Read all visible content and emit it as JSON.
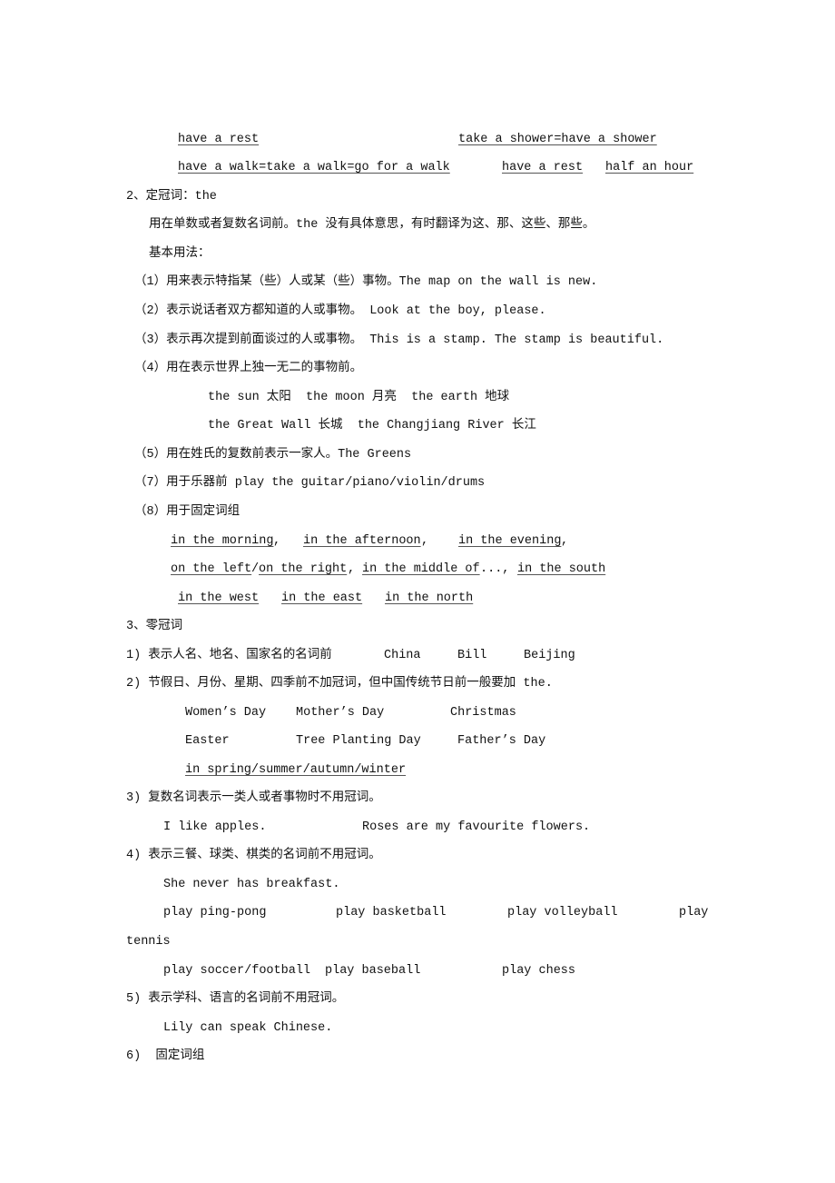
{
  "l1": [
    "have a rest",
    "take a shower=have a shower"
  ],
  "l2": [
    "have a walk=take a walk=go for a walk",
    "have a rest",
    "half an hour"
  ],
  "s2_title": "2、定冠词：the",
  "s2_intro": "用在单数或者复数名词前。the 没有具体意思，有时翻译为这、那、这些、那些。",
  "s2_basic": "基本用法：",
  "s2_items": [
    "（1）用来表示特指某（些）人或某（些）事物。The map on the wall is new.",
    "（2）表示说话者双方都知道的人或事物。 Look at the boy, please.",
    "（3）表示再次提到前面谈过的人或事物。 This is a stamp. The stamp is beautiful.",
    "（4）用在表示世界上独一无二的事物前。",
    "the sun 太阳  the moon 月亮  the earth 地球",
    "the Great Wall 长城  the Changjiang River 长江",
    "（5）用在姓氏的复数前表示一家人。The Greens",
    "（7）用于乐器前 play the guitar/piano/violin/drums",
    "（8）用于固定词组"
  ],
  "phrases1": [
    "in the morning",
    ",",
    "in the afternoon",
    ",",
    "in the evening",
    ","
  ],
  "phrases2": [
    "on the left",
    "/",
    "on the right",
    ",",
    "in the middle of",
    "...,",
    "in the south"
  ],
  "phrases3": [
    "in the west",
    "in the east",
    "in the north"
  ],
  "s3_title": "3、零冠词",
  "s3_1": [
    "1) 表示人名、地名、国家名的名词前",
    "China",
    "Bill",
    "Beijing"
  ],
  "s3_2": "2) 节假日、月份、星期、四季前不加冠词，但中国传统节日前一般要加 the.",
  "holidays1": [
    "Women’s Day",
    "Mother’s Day",
    "Christmas"
  ],
  "holidays2": [
    "Easter",
    "Tree Planting Day",
    "Father’s Day"
  ],
  "seasons": "in spring/summer/autumn/winter",
  "s3_3": "3) 复数名词表示一类人或者事物时不用冠词。",
  "s3_3_ex": [
    "I like apples.",
    "Roses are my favourite flowers."
  ],
  "s3_4": "4) 表示三餐、球类、棋类的名词前不用冠词。",
  "s3_4_ex": "She never has breakfast.",
  "sports1": [
    "play ping-pong",
    "play basketball",
    "play volleyball",
    "play"
  ],
  "sports1_wrap": "tennis",
  "sports2": [
    "play soccer/football",
    "play baseball",
    "play chess"
  ],
  "s3_5": "5) 表示学科、语言的名词前不用冠词。",
  "s3_5_ex": "Lily can speak Chinese.",
  "s3_6": "6)  固定词组"
}
